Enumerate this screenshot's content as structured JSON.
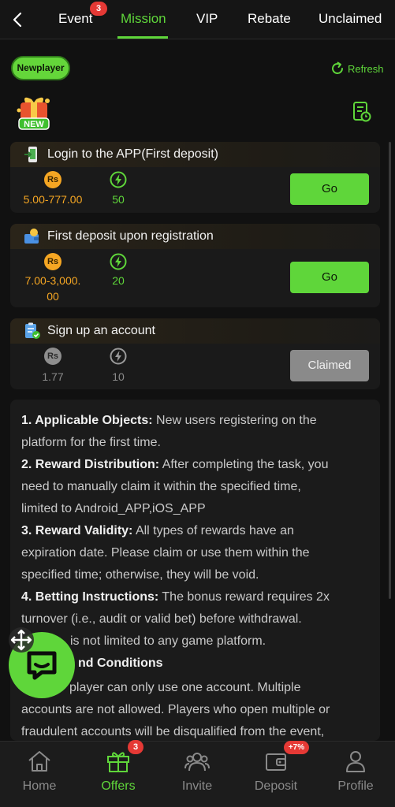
{
  "colors": {
    "accent": "#5fd63a",
    "gold": "#f5a623",
    "badge": "#e53935",
    "background": "#111111"
  },
  "topnav": {
    "back_icon": "chevron-left-icon",
    "tabs": [
      {
        "label": "Event",
        "badge": "3"
      },
      {
        "label": "Mission",
        "active": true
      },
      {
        "label": "VIP"
      },
      {
        "label": "Rebate"
      },
      {
        "label": "Unclaimed"
      }
    ]
  },
  "section": {
    "filter_label": "Newplayer",
    "refresh_label": "Refresh",
    "logo_icon": "new-gift-icon",
    "record_icon": "document-clock-icon"
  },
  "missions": [
    {
      "title": "Login to the APP(First deposit)",
      "icon": "phone-login-icon",
      "reward_amount": "5.00-777.00",
      "points": "50",
      "button": "Go",
      "state": "available"
    },
    {
      "title": "First deposit upon registration",
      "icon": "deposit-wallet-icon",
      "reward_amount_line1": "7.00-3,000.",
      "reward_amount_line2": "00",
      "points": "20",
      "button": "Go",
      "state": "available"
    },
    {
      "title": "Sign up an account",
      "icon": "clipboard-check-icon",
      "reward_amount": "1.77",
      "points": "10",
      "button": "Claimed",
      "state": "claimed"
    }
  ],
  "currency_symbol": "Rs",
  "rules": {
    "l1_bold": "1. Applicable Objects:",
    "l1_text": " New users registering on the",
    "l2": "platform for the first time.",
    "l3_bold": "2. Reward Distribution:",
    "l3_text": " After completing the task, you",
    "l4": "need to manually claim it within the specified time,",
    "l5": "limited to Android_APP,iOS_APP",
    "l6_bold": "3. Reward Validity:",
    "l6_text": " All types of rewards have an",
    "l7": "expiration date. Please claim or use them within the",
    "l8": "specified time; otherwise, they will be void.",
    "l9_bold": "4. Betting Instructions:",
    "l9_text": " The bonus reward requires 2x",
    "l10": "turnover (i.e., audit or valid bet) before withdrawal.",
    "l11": "is not limited to any game platform.",
    "l12_bold": "nd Conditions",
    "l13": "player can only use one account. Multiple",
    "l14": "accounts are not allowed. Players who open multiple or",
    "l15": "fraudulent accounts will be disqualified from the event,"
  },
  "floating": {
    "chat_icon": "chat-bubble-icon",
    "move_icon": "move-arrows-icon"
  },
  "bottomnav": {
    "items": [
      {
        "label": "Home",
        "icon": "home-icon"
      },
      {
        "label": "Offers",
        "icon": "gift-icon",
        "badge": "3",
        "active": true
      },
      {
        "label": "Invite",
        "icon": "invite-users-icon"
      },
      {
        "label": "Deposit",
        "icon": "wallet-icon",
        "badge": "+7%"
      },
      {
        "label": "Profile",
        "icon": "profile-icon"
      }
    ]
  }
}
